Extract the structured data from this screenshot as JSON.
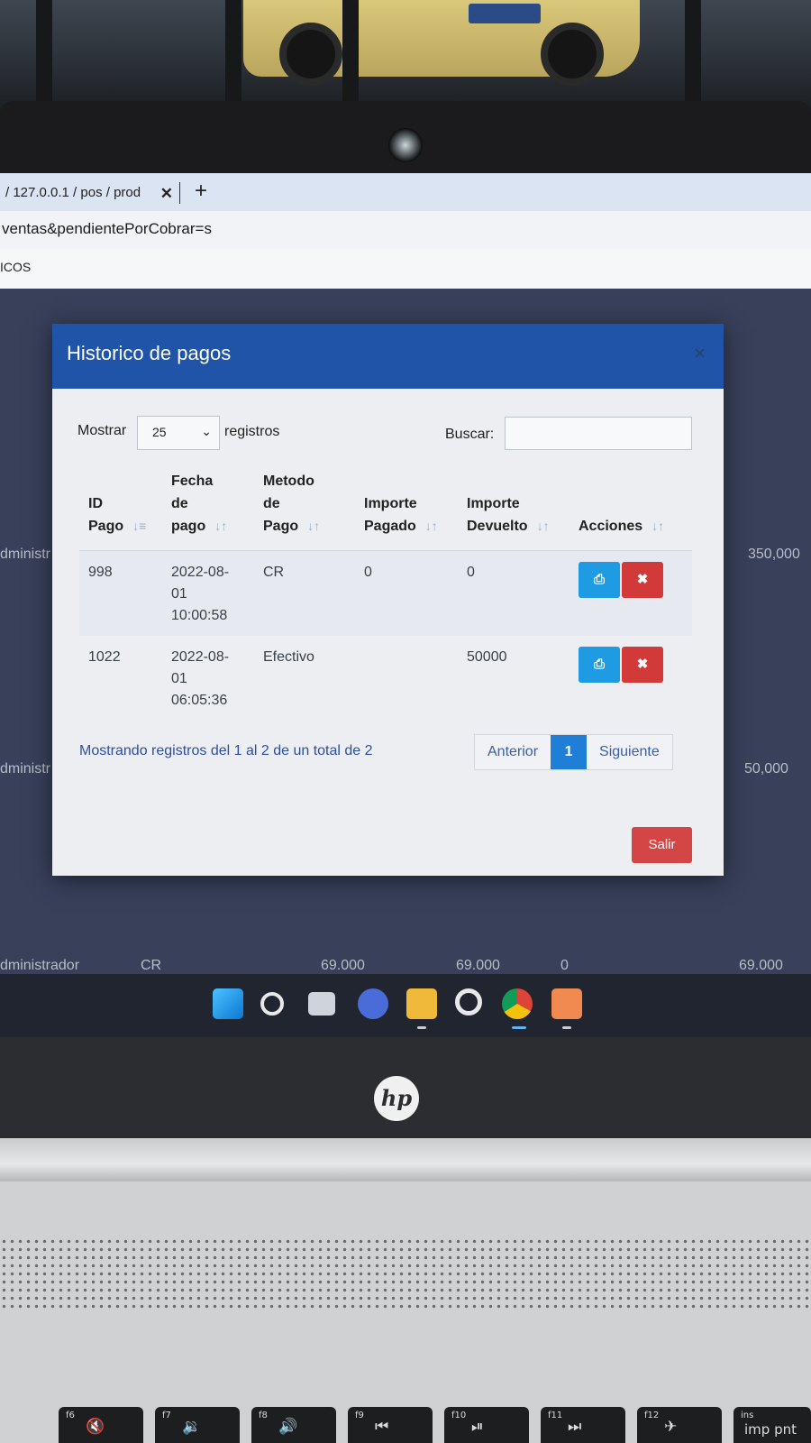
{
  "browser": {
    "tab_title": "/ 127.0.0.1 / pos / prod",
    "tab_close": "✕",
    "new_tab": "+",
    "address": "ventas&pendientePorCobrar=s",
    "bookmark": "ICOS"
  },
  "background_rows": [
    {
      "user": "dministr",
      "amount": "350,000"
    },
    {
      "user": "dministr",
      "amount": "50,000"
    },
    {
      "user": "dministrador",
      "method": "CR",
      "paid": "69.000",
      "paid2": "69.000",
      "change": "0",
      "total": "69.000"
    }
  ],
  "modal": {
    "title": "Historico de pagos",
    "close": "×",
    "length_label": "Mostrar",
    "length_value": "25",
    "length_suffix": "registros",
    "search_label": "Buscar:",
    "search_value": "",
    "columns": [
      {
        "label": "ID Pago",
        "lines": [
          "ID",
          "Pago"
        ],
        "sort_icon": "sort-asc-icon"
      },
      {
        "label": "Fecha de pago",
        "lines": [
          "Fecha",
          "de",
          "pago"
        ],
        "sort_icon": "sort-icon"
      },
      {
        "label": "Metodo de Pago",
        "lines": [
          "Metodo",
          "de",
          "Pago"
        ],
        "sort_icon": "sort-icon"
      },
      {
        "label": "Importe Pagado",
        "lines": [
          "Importe",
          "Pagado"
        ],
        "sort_icon": "sort-icon"
      },
      {
        "label": "Importe Devuelto",
        "lines": [
          "Importe",
          "Devuelto"
        ],
        "sort_icon": "sort-icon"
      },
      {
        "label": "Acciones",
        "lines": [
          "Acciones"
        ],
        "sort_icon": "sort-icon"
      }
    ],
    "rows": [
      {
        "id": "998",
        "date_lines": [
          "2022-08-",
          "01",
          "10:00:58"
        ],
        "method": "CR",
        "paid": "0",
        "returned": "0"
      },
      {
        "id": "1022",
        "date_lines": [
          "2022-08-",
          "01",
          "06:05:36"
        ],
        "method": "Efectivo",
        "paid": "",
        "returned": "50000"
      }
    ],
    "info": "Mostrando registros del 1 al 2 de un total de 2",
    "pagination": {
      "prev": "Anterior",
      "current": "1",
      "next": "Siguiente"
    },
    "exit_label": "Salir"
  },
  "taskbar_icons": [
    "windows-start-icon",
    "search-icon",
    "task-view-icon",
    "meet-icon",
    "file-explorer-icon",
    "app-icon",
    "chrome-icon",
    "xampp-icon"
  ],
  "laptop": {
    "brand": "hp"
  },
  "keyboard": [
    {
      "fn": "f6",
      "sym": "🔇"
    },
    {
      "fn": "f7",
      "sym": "🔉"
    },
    {
      "fn": "f8",
      "sym": "🔊"
    },
    {
      "fn": "f9",
      "sym": "⏮"
    },
    {
      "fn": "f10",
      "sym": "⏯"
    },
    {
      "fn": "f11",
      "sym": "⏭"
    },
    {
      "fn": "f12",
      "sym": "✈"
    },
    {
      "fn": "ins",
      "sym": "imp pnt"
    }
  ]
}
